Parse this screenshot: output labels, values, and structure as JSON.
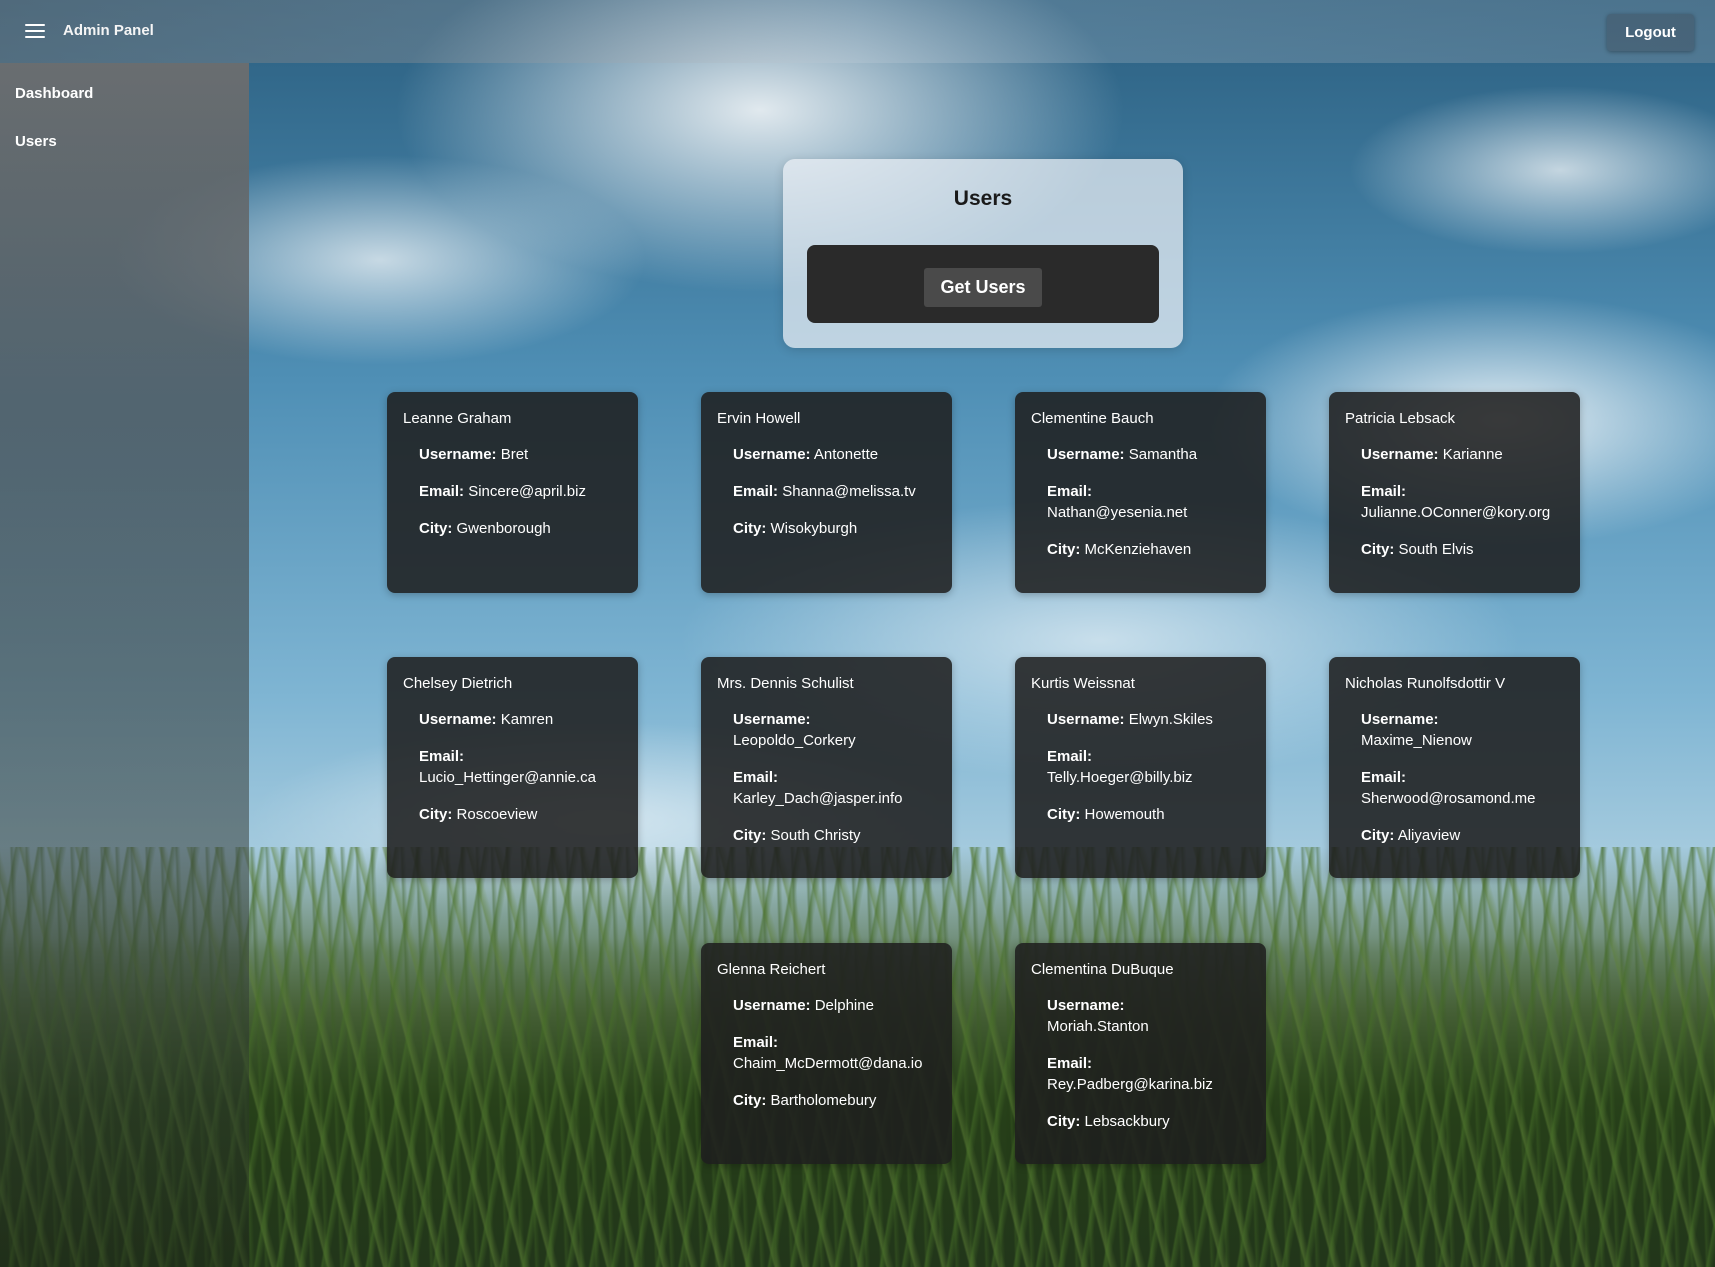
{
  "app": {
    "title": "Admin Panel",
    "logout_label": "Logout"
  },
  "sidebar": {
    "items": [
      {
        "label": "Dashboard"
      },
      {
        "label": "Users"
      }
    ]
  },
  "main": {
    "title": "Users",
    "get_users_label": "Get Users",
    "field_labels": {
      "username": "Username:",
      "email": "Email:",
      "city": "City:"
    },
    "users": [
      {
        "name": "Leanne Graham",
        "username": "Bret",
        "email": "Sincere@april.biz",
        "city": "Gwenborough"
      },
      {
        "name": "Ervin Howell",
        "username": "Antonette",
        "email": "Shanna@melissa.tv",
        "city": "Wisokyburgh"
      },
      {
        "name": "Clementine Bauch",
        "username": "Samantha",
        "email": "Nathan@yesenia.net",
        "city": "McKenziehaven"
      },
      {
        "name": "Patricia Lebsack",
        "username": "Karianne",
        "email": "Julianne.OConner@kory.org",
        "city": "South Elvis"
      },
      {
        "name": "Chelsey Dietrich",
        "username": "Kamren",
        "email": "Lucio_Hettinger@annie.ca",
        "city": "Roscoeview"
      },
      {
        "name": "Mrs. Dennis Schulist",
        "username": "Leopoldo_Corkery",
        "email": "Karley_Dach@jasper.info",
        "city": "South Christy"
      },
      {
        "name": "Kurtis Weissnat",
        "username": "Elwyn.Skiles",
        "email": "Telly.Hoeger@billy.biz",
        "city": "Howemouth"
      },
      {
        "name": "Nicholas Runolfsdottir V",
        "username": "Maxime_Nienow",
        "email": "Sherwood@rosamond.me",
        "city": "Aliyaview"
      },
      {
        "name": "Glenna Reichert",
        "username": "Delphine",
        "email": "Chaim_McDermott@dana.io",
        "city": "Bartholomebury"
      },
      {
        "name": "Clementina DuBuque",
        "username": "Moriah.Stanton",
        "email": "Rey.Padberg@karina.biz",
        "city": "Lebsackbury"
      }
    ]
  },
  "icons": {
    "menu": "hamburger-menu-icon"
  }
}
